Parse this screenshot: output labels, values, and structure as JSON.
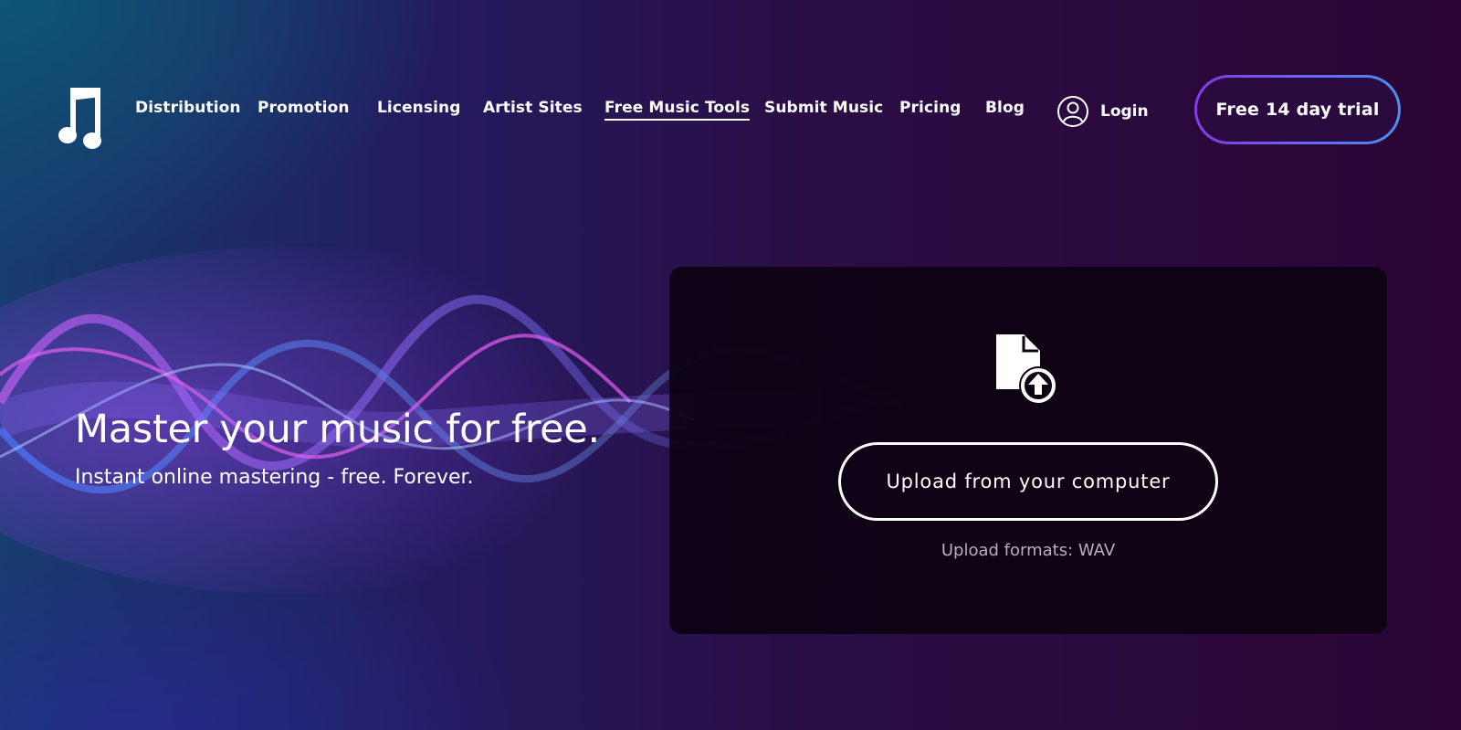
{
  "nav": {
    "logo": "music-note-logo",
    "links": [
      {
        "label": "Distribution"
      },
      {
        "label": "Promotion"
      },
      {
        "label": "Licensing"
      },
      {
        "label": "Artist Sites"
      },
      {
        "label": "Free Music Tools",
        "active": true
      },
      {
        "label": "Submit Music"
      },
      {
        "label": "Pricing"
      },
      {
        "label": "Blog"
      }
    ],
    "login_label": "Login",
    "trial_label": "Free 14 day trial"
  },
  "hero": {
    "title": "Master your music for free.",
    "subtitle": "Instant online mastering - free. Forever."
  },
  "upload": {
    "icon": "file-upload-icon",
    "button_label": "Upload from your computer",
    "formats_text": "Upload formats: WAV"
  },
  "colors": {
    "trial_gradient_start": "#8a38e6",
    "trial_gradient_end": "#4a90f0",
    "card_background": "#0d0212"
  }
}
